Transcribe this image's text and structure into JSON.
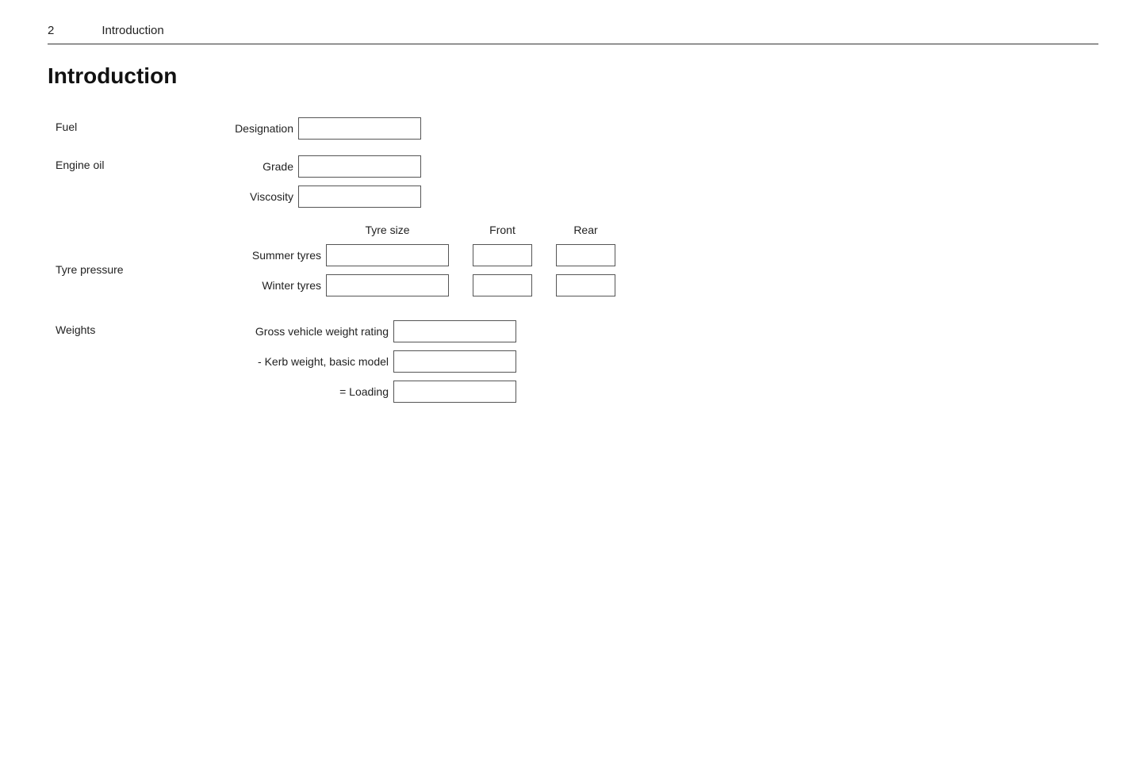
{
  "header": {
    "page_number": "2",
    "title": "Introduction"
  },
  "page_title": "Introduction",
  "sections": {
    "fuel": {
      "label": "Fuel",
      "fields": [
        {
          "label": "Designation",
          "type": "normal"
        }
      ]
    },
    "engine_oil": {
      "label": "Engine oil",
      "fields": [
        {
          "label": "Grade",
          "type": "normal"
        },
        {
          "label": "Viscosity",
          "type": "normal"
        }
      ]
    },
    "tyre_pressure": {
      "label": "Tyre pressure",
      "column_headers": {
        "tyre_size": "Tyre size",
        "front": "Front",
        "rear": "Rear"
      },
      "rows": [
        {
          "label": "Summer tyres"
        },
        {
          "label": "Winter tyres"
        }
      ]
    },
    "weights": {
      "label": "Weights",
      "fields": [
        {
          "label": "Gross vehicle weight rating",
          "type": "normal"
        },
        {
          "label": "- Kerb weight, basic model",
          "type": "normal"
        },
        {
          "label": "= Loading",
          "type": "normal"
        }
      ]
    }
  }
}
